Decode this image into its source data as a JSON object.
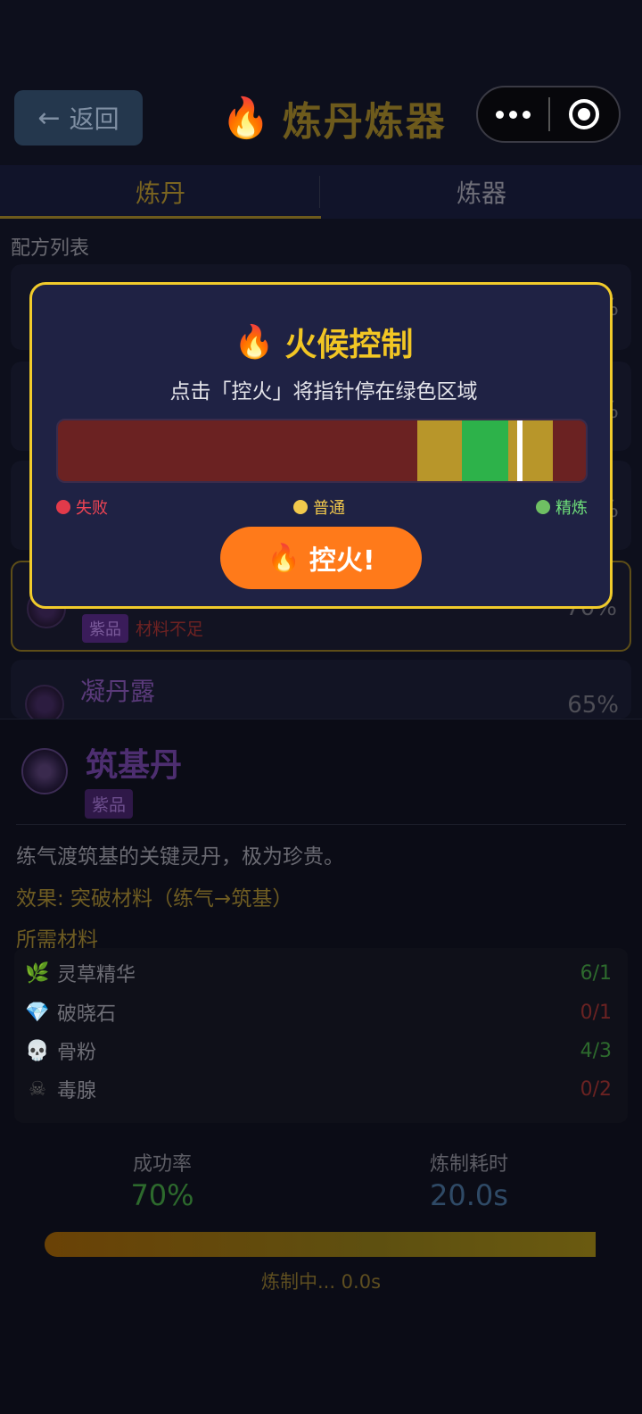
{
  "header": {
    "back_arrow": "←",
    "back_label": "返回",
    "title_icon": "🔥",
    "title": "炼丹炼器"
  },
  "tabs": [
    {
      "label": "炼丹",
      "active": true
    },
    {
      "label": "炼器",
      "active": false
    }
  ],
  "recipe_list": {
    "section_label": "配方列表",
    "items": [
      {
        "pct": "%"
      },
      {
        "pct": "%"
      },
      {
        "pct": "%"
      },
      {
        "pct": "70%",
        "badge": "紫品",
        "warning": "材料不足",
        "highlighted": true
      },
      {
        "name": "凝丹露",
        "pct": "65%"
      }
    ]
  },
  "modal": {
    "title_icon": "🔥",
    "title": "火候控制",
    "subtitle": "点击「控火」将指针停在绿色区域",
    "meter_colors": {
      "fail": "#6b2222",
      "normal": "#b8962a",
      "perfect": "#2db24a"
    },
    "needle_position_pct": 87,
    "legend": [
      {
        "label": "失败",
        "color": "#e23a4a",
        "text_color": "#ef4454"
      },
      {
        "label": "普通",
        "color": "#f2c94c",
        "text_color": "#f2c94c"
      },
      {
        "label": "精炼",
        "color": "#6fbf63",
        "text_color": "#6fe07a"
      }
    ],
    "button_icon": "🔥",
    "button_label": "控火!"
  },
  "detail": {
    "name": "筑基丹",
    "badge": "紫品",
    "description": "练气渡筑基的关键灵丹，极为珍贵。",
    "effect": "效果: 突破材料（练气→筑基）",
    "materials_title": "所需材料",
    "materials": [
      {
        "icon": "herb-icon",
        "glyph": "🌿",
        "name": "灵草精华",
        "count": "6/1",
        "enough": true
      },
      {
        "icon": "gem-icon",
        "glyph": "💎",
        "name": "破晓石",
        "count": "0/1",
        "enough": false
      },
      {
        "icon": "skull-icon",
        "glyph": "💀",
        "name": "骨粉",
        "count": "4/3",
        "enough": true
      },
      {
        "icon": "poison-icon",
        "glyph": "☠",
        "name": "毒腺",
        "count": "0/2",
        "enough": false
      }
    ],
    "stats": {
      "success_label": "成功率",
      "success_value": "70%",
      "time_label": "炼制耗时",
      "time_value": "20.0s"
    },
    "progress_fraction": 1.0,
    "progress_text": "炼制中... 0.0s"
  }
}
